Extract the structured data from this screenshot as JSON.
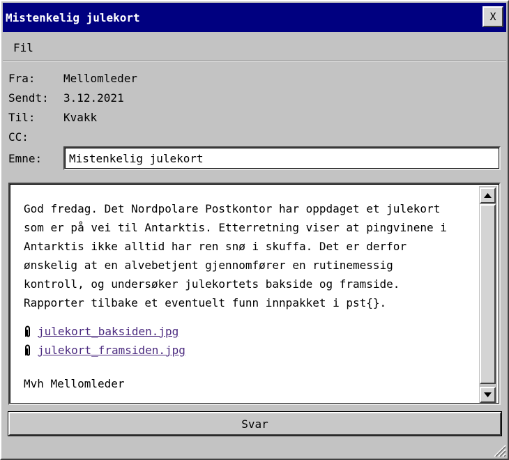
{
  "window": {
    "title": "Mistenkelig julekort",
    "close_label": "X"
  },
  "menu": {
    "items": [
      "Fil"
    ]
  },
  "header": {
    "from_label": "Fra:",
    "from_value": "Mellomleder",
    "sent_label": "Sendt:",
    "sent_value": "3.12.2021",
    "to_label": "Til:",
    "to_value": "Kvakk",
    "cc_label": "CC:",
    "cc_value": "",
    "subject_label": "Emne:",
    "subject_value": "Mistenkelig julekort"
  },
  "body": {
    "paragraph": "God fredag. Det Nordpolare Postkontor har oppdaget et julekort\nsom er på vei til Antarktis. Etterretning viser at pingvinene i\nAntarktis ikke alltid har ren snø i skuffa. Det er derfor\nønskelig at en alvebetjent gjennomfører en rutinemessig\nkontroll, og undersøker julekortets bakside og framside.\nRapporter tilbake et eventuelt funn innpakket i pst{}.",
    "attachments": [
      "julekort_baksiden.jpg",
      "julekort_framsiden.jpg"
    ],
    "signature": "Mvh Mellomleder"
  },
  "actions": {
    "reply_label": "Svar"
  },
  "icons": {
    "attachment": "paperclip-icon",
    "scroll_up": "arrow-up-icon",
    "scroll_down": "arrow-down-icon",
    "resize": "resize-grip-icon"
  },
  "colors": {
    "titlebar": "#000080",
    "link": "#4b2a7f",
    "window": "#c3c3c3"
  }
}
